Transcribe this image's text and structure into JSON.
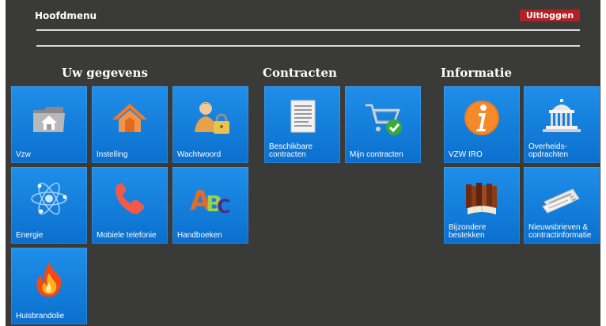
{
  "header": {
    "title": "Hoofdmenu",
    "logout_label": "Uitloggen"
  },
  "sections": {
    "uw_gegevens": {
      "title": "Uw gegevens",
      "tiles": [
        {
          "label": "Vzw",
          "icon": "home-folder-icon"
        },
        {
          "label": "Instelling",
          "icon": "house-icon"
        },
        {
          "label": "Wachtwoord",
          "icon": "user-lock-icon"
        },
        {
          "label": "Energie",
          "icon": "atom-icon"
        },
        {
          "label": "Mobiele telefonie",
          "icon": "phone-icon"
        },
        {
          "label": "Handboeken",
          "icon": "abc-icon"
        },
        {
          "label": "Huisbrandolie",
          "icon": "fire-icon"
        }
      ]
    },
    "contracten": {
      "title": "Contracten",
      "tiles": [
        {
          "label": "Beschikbare contracten",
          "icon": "document-icon"
        },
        {
          "label": "Mijn contracten",
          "icon": "shopping-cart-check-icon"
        }
      ]
    },
    "informatie": {
      "title": "Informatie",
      "tiles": [
        {
          "label": "VZW IRO",
          "icon": "info-icon"
        },
        {
          "label": "Overheids-opdrachten",
          "icon": "government-building-icon"
        },
        {
          "label": "Bijzondere bestekken",
          "icon": "books-icon"
        },
        {
          "label": "Nieuwsbrieven & contractinformatie",
          "icon": "newspaper-icon"
        }
      ]
    }
  },
  "colors": {
    "background": "#3a3a38",
    "tile": "#1a84e0",
    "logout": "#b41f24"
  }
}
